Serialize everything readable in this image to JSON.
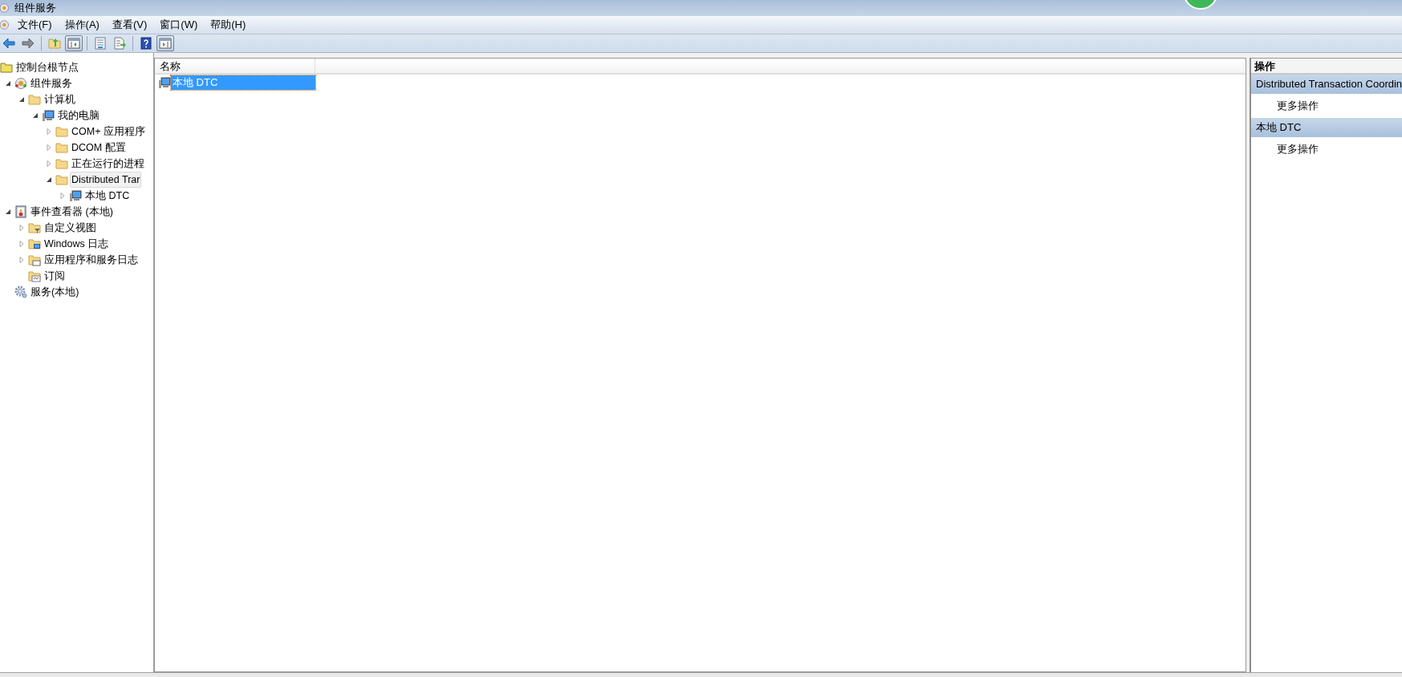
{
  "window": {
    "title": "组件服务"
  },
  "menu": [
    "文件(F)",
    "操作(A)",
    "查看(V)",
    "窗口(W)",
    "帮助(H)"
  ],
  "toolbar": [
    {
      "kind": "back",
      "pressed": false
    },
    {
      "kind": "forward",
      "pressed": false
    },
    {
      "kind": "separator"
    },
    {
      "kind": "up",
      "pressed": false
    },
    {
      "kind": "tree-pane",
      "pressed": true
    },
    {
      "kind": "separator"
    },
    {
      "kind": "properties",
      "pressed": false
    },
    {
      "kind": "export",
      "pressed": false
    },
    {
      "kind": "separator"
    },
    {
      "kind": "help",
      "pressed": false
    },
    {
      "kind": "action-pane",
      "pressed": true
    }
  ],
  "tree": [
    {
      "label": "控制台根节点",
      "kind": "console",
      "selected": false,
      "children": [
        {
          "label": "组件服务",
          "kind": "component",
          "expanded": true,
          "selected": false,
          "children": [
            {
              "label": "计算机",
              "kind": "folder",
              "expanded": true,
              "selected": false,
              "children": [
                {
                  "label": "我的电脑",
                  "kind": "computer",
                  "expanded": true,
                  "selected": false,
                  "children": [
                    {
                      "label": "COM+ 应用程序",
                      "kind": "folder",
                      "expanded": false,
                      "selected": false
                    },
                    {
                      "label": "DCOM 配置",
                      "kind": "folder",
                      "expanded": false,
                      "selected": false
                    },
                    {
                      "label": "正在运行的进程",
                      "kind": "folder",
                      "expanded": false,
                      "selected": false
                    },
                    {
                      "label": "Distributed Trar",
                      "kind": "folder",
                      "expanded": true,
                      "selected": true,
                      "children": [
                        {
                          "label": "本地 DTC",
                          "kind": "computer",
                          "expanded": false,
                          "selected": false
                        }
                      ]
                    }
                  ]
                }
              ]
            }
          ]
        },
        {
          "label": "事件查看器 (本地)",
          "kind": "eventlog",
          "expanded": true,
          "selected": false,
          "children": [
            {
              "label": "自定义视图",
              "kind": "folder-filter",
              "expanded": false,
              "selected": false
            },
            {
              "label": "Windows 日志",
              "kind": "folder-computer",
              "expanded": false,
              "selected": false
            },
            {
              "label": "应用程序和服务日志",
              "kind": "folder-window",
              "expanded": false,
              "selected": false
            },
            {
              "label": "订阅",
              "kind": "subscription",
              "selected": false
            }
          ]
        },
        {
          "label": "服务(本地)",
          "kind": "gear",
          "selected": false
        }
      ]
    }
  ],
  "list": {
    "columns": [
      "名称"
    ],
    "rows": [
      {
        "name": "本地 DTC",
        "kind": "computer",
        "selected": true
      }
    ]
  },
  "actions": {
    "title": "操作",
    "sections": [
      {
        "title": "Distributed Transaction Coordin",
        "items": [
          "更多操作"
        ]
      },
      {
        "title": "本地 DTC",
        "items": [
          "更多操作"
        ]
      }
    ]
  }
}
